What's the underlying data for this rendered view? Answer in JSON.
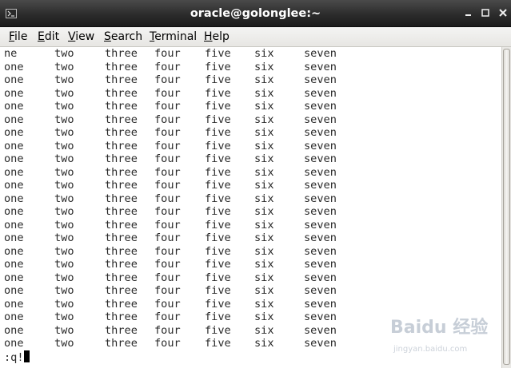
{
  "window": {
    "title": "oracle@golonglee:~"
  },
  "menu": [
    {
      "mnemonic": "F",
      "rest": "ile"
    },
    {
      "mnemonic": "E",
      "rest": "dit"
    },
    {
      "mnemonic": "V",
      "rest": "iew"
    },
    {
      "mnemonic": "S",
      "rest": "earch"
    },
    {
      "mnemonic": "T",
      "rest": "erminal"
    },
    {
      "mnemonic": "H",
      "rest": "elp"
    }
  ],
  "terminal": {
    "first_row": [
      "ne",
      "two",
      "three",
      "four",
      "five",
      "six",
      "seven"
    ],
    "row": [
      "one",
      "two",
      "three",
      "four",
      "five",
      "six",
      "seven"
    ],
    "row_count": 23,
    "command": ":q!"
  },
  "watermark": {
    "logo": "Baidu 经验",
    "url": "jingyan.baidu.com"
  },
  "icons": {
    "terminal": "terminal-icon",
    "minimize": "minimize-icon",
    "maximize": "maximize-icon",
    "close": "close-icon",
    "watermark_paw": "baidu-paw-icon"
  },
  "colors": {
    "titlebar": "#2c2c2c",
    "title_text": "#ffffff",
    "menubar": "#ecebe8",
    "terminal_bg": "#ffffff",
    "terminal_text": "#2a2a2a"
  }
}
